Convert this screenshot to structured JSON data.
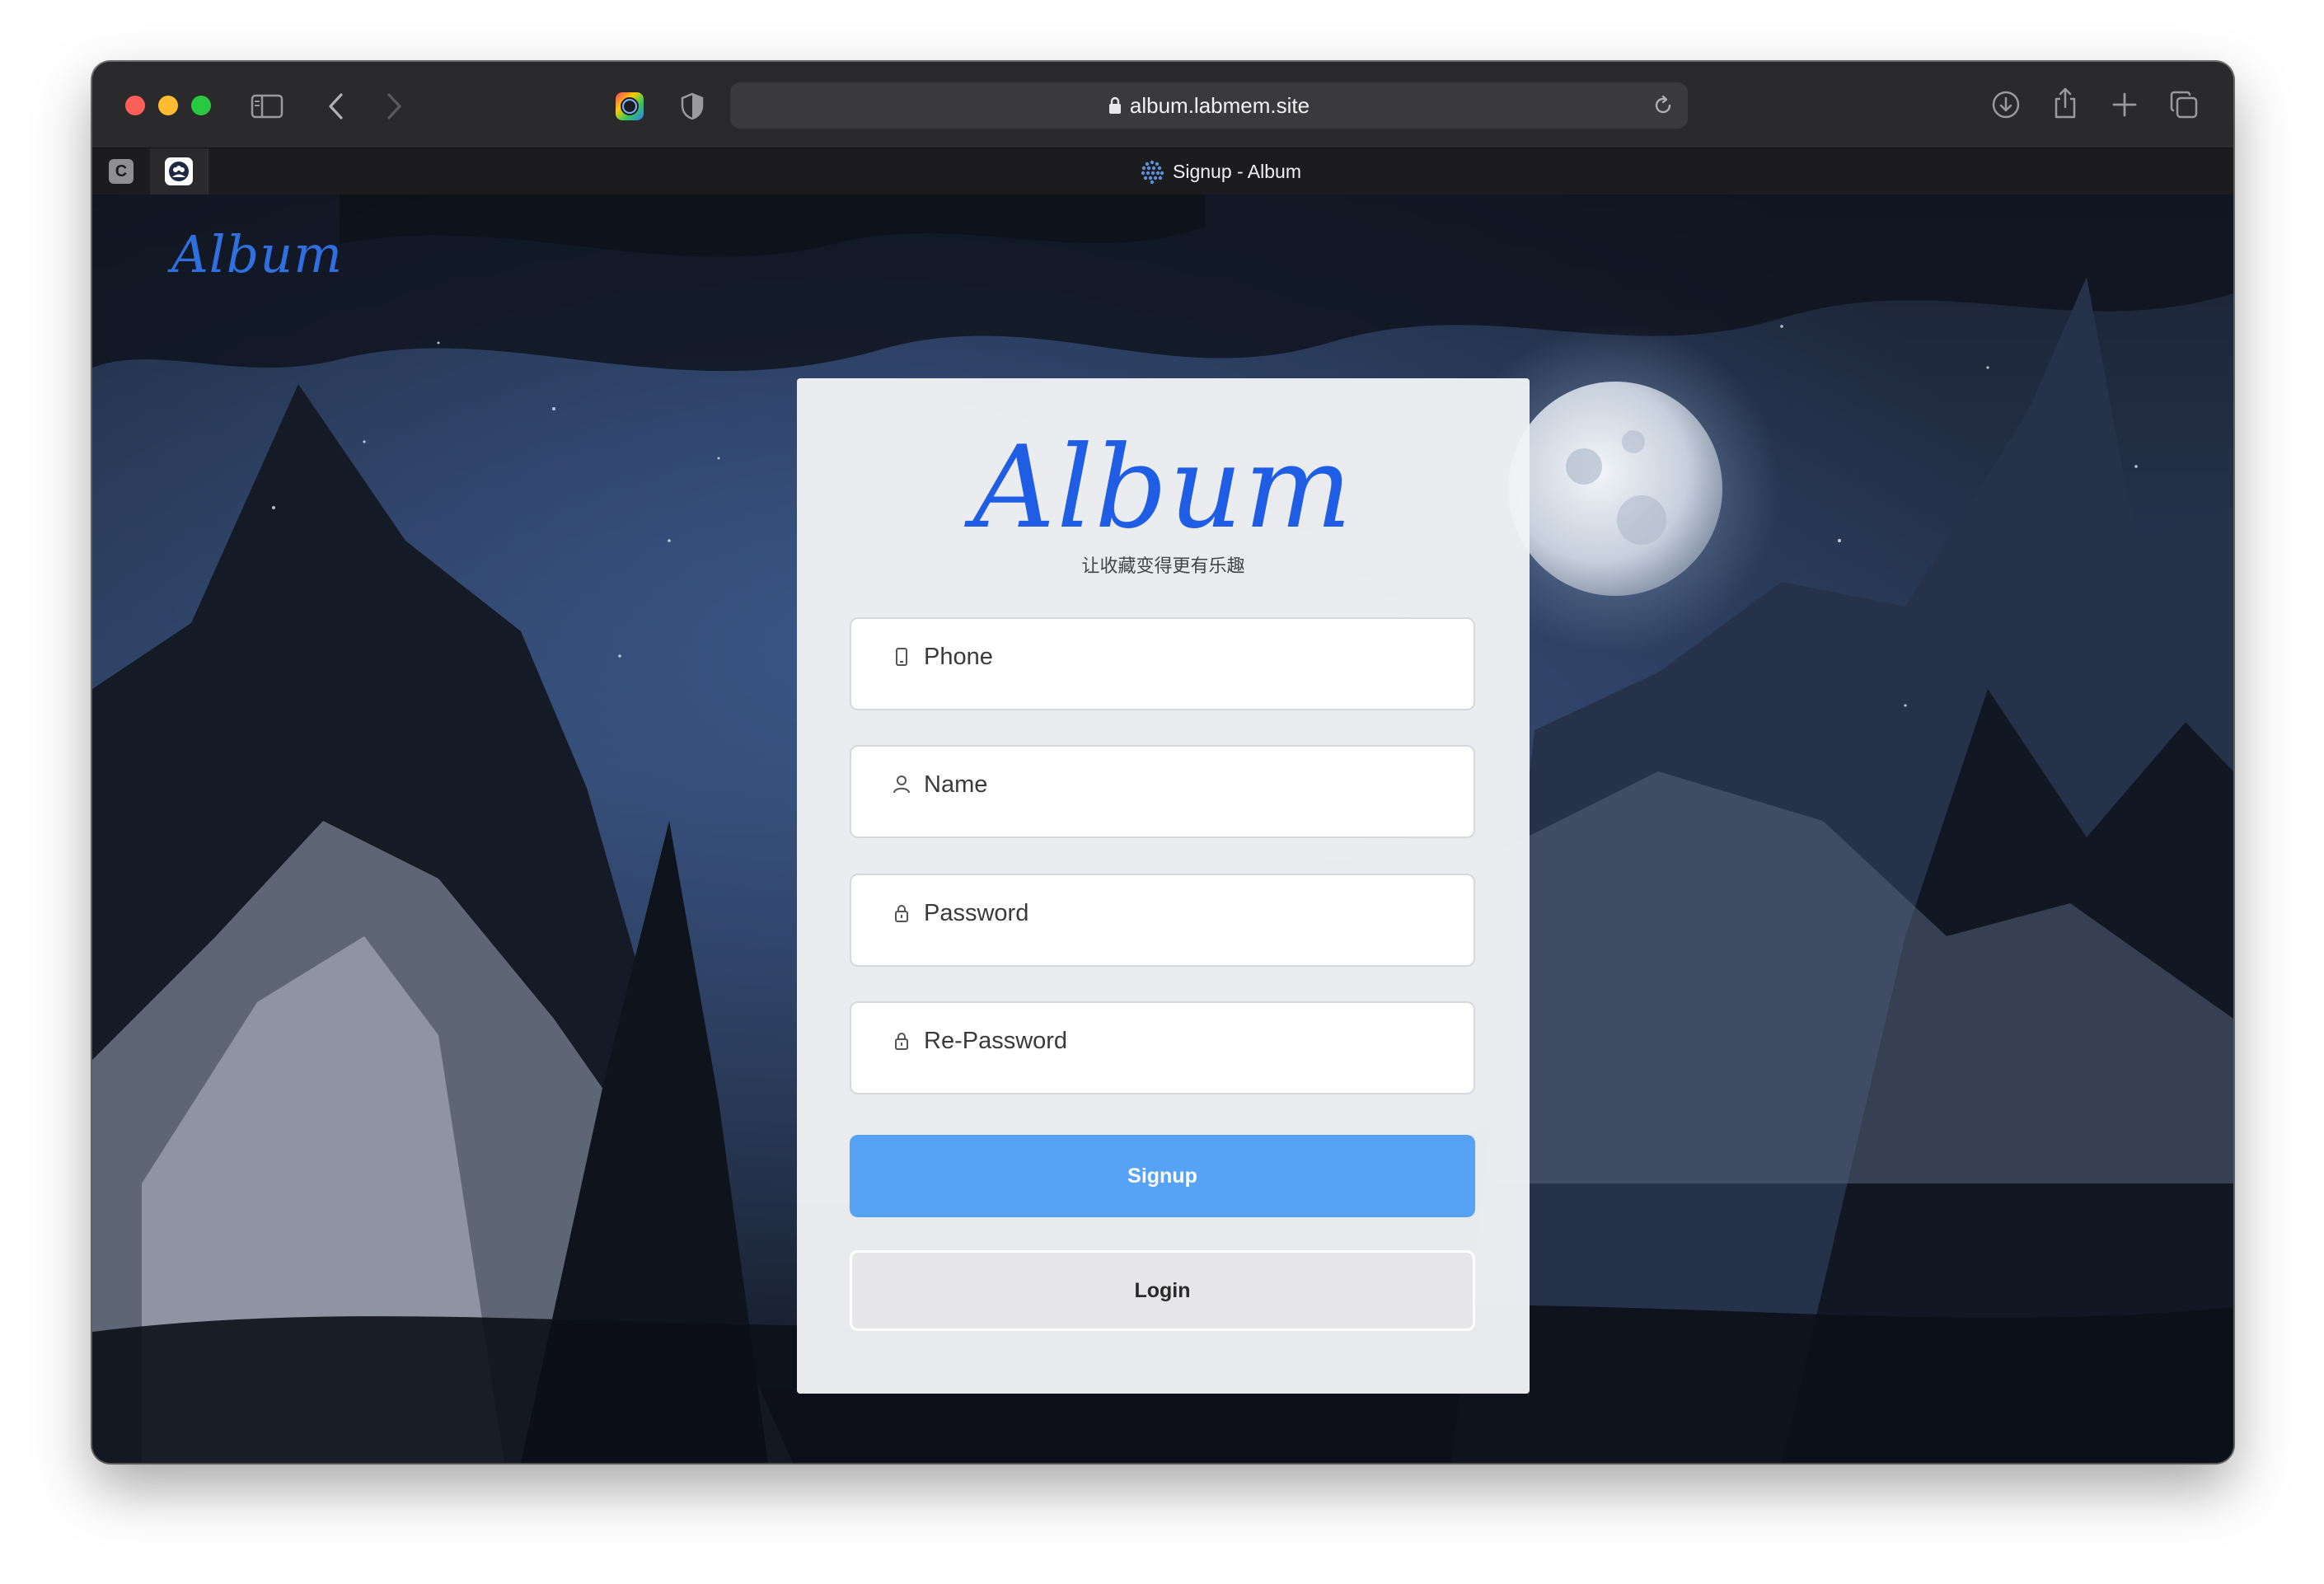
{
  "browser": {
    "url": "album.labmem.site",
    "tab_title": "Signup - Album",
    "pinned_tab_1_letter": "C"
  },
  "page": {
    "header_logo": "Album",
    "card_logo": "Album",
    "slogan": "让收藏变得更有乐趣",
    "fields": {
      "phone_placeholder": "Phone",
      "name_placeholder": "Name",
      "password_placeholder": "Password",
      "repassword_placeholder": "Re-Password"
    },
    "signup_label": "Signup",
    "login_label": "Login"
  },
  "colors": {
    "accent": "#56a2f5",
    "logo": "#1f5ee4"
  },
  "icons": {
    "phone_field": "mobile-phone-icon",
    "name_field": "user-icon",
    "password_field": "lock-icon",
    "repassword_field": "lock-icon"
  }
}
